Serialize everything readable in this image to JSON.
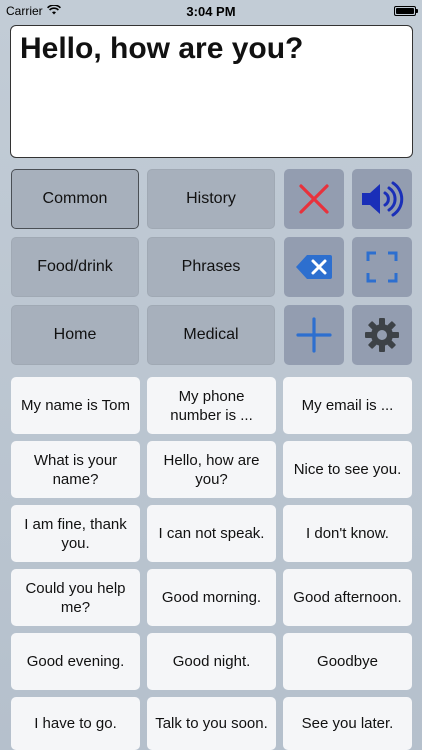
{
  "status_bar": {
    "carrier": "Carrier",
    "time": "3:04 PM"
  },
  "text_area": {
    "value": "Hello, how are you?"
  },
  "categories": [
    {
      "label": "Common",
      "selected": true
    },
    {
      "label": "History"
    },
    {
      "label": "Food/drink"
    },
    {
      "label": "Phrases"
    },
    {
      "label": "Home"
    },
    {
      "label": "Medical"
    }
  ],
  "tools": {
    "clear_icon": "close-icon",
    "speak_icon": "speaker-icon",
    "backspace_icon": "backspace-icon",
    "fullscreen_icon": "fullscreen-icon",
    "add_icon": "plus-icon",
    "settings_icon": "gear-icon",
    "colors": {
      "clear": "#e8323c",
      "speak": "#1a2fb8",
      "backspace": "#2d6fcf",
      "fullscreen": "#2d6fcf",
      "add": "#2d6fcf",
      "settings": "#3d4247"
    }
  },
  "phrases": [
    "My name is Tom",
    "My phone number is ...",
    "My email is ...",
    "What is your name?",
    "Hello, how are you?",
    "Nice to see you.",
    "I am fine, thank you.",
    "I can not speak.",
    "I don't know.",
    "Could you help me?",
    "Good morning.",
    "Good afternoon.",
    "Good evening.",
    "Good night.",
    "Goodbye",
    "I have to go.",
    "Talk to you soon.",
    "See you later."
  ]
}
